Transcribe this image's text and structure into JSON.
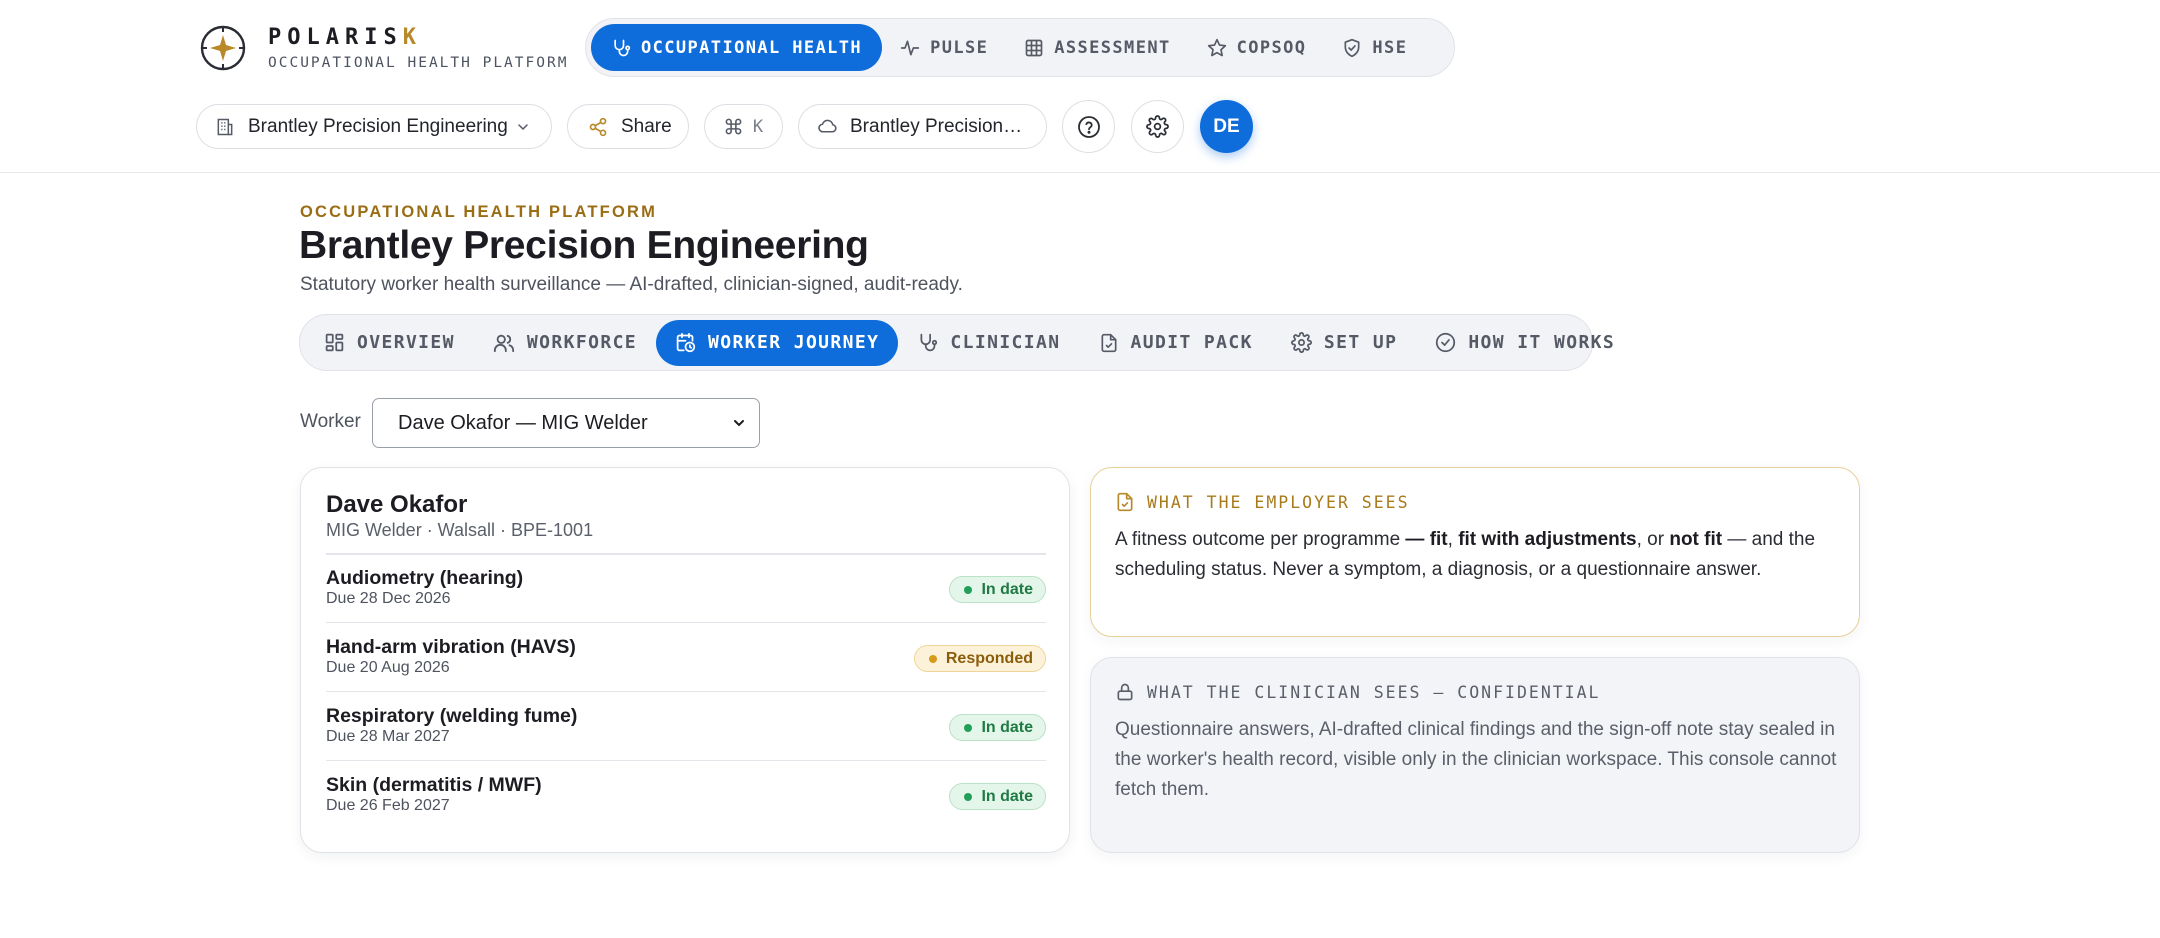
{
  "brand": {
    "name_main": "POLARIS",
    "name_accent": "K",
    "subtitle": "OCCUPATIONAL HEALTH PLATFORM",
    "accent_color": "#b8892a"
  },
  "main_nav": [
    {
      "label": "OCCUPATIONAL HEALTH",
      "icon": "stethoscope-icon",
      "active": true
    },
    {
      "label": "PULSE",
      "icon": "pulse-icon",
      "active": false
    },
    {
      "label": "ASSESSMENT",
      "icon": "grid-icon",
      "active": false
    },
    {
      "label": "COPSOQ",
      "icon": "star-icon",
      "active": false
    },
    {
      "label": "HSE",
      "icon": "shield-check-icon",
      "active": false
    }
  ],
  "toolbar": {
    "org_label": "Brantley Precision Engineering",
    "share_label": "Share",
    "shortcut_key": "K",
    "cloud_label": "Brantley Precision Engineering",
    "avatar_initials": "DE"
  },
  "page": {
    "eyebrow": "OCCUPATIONAL HEALTH PLATFORM",
    "title": "Brantley Precision Engineering",
    "subtitle": "Statutory worker health surveillance — AI-drafted, clinician-signed, audit-ready."
  },
  "sub_nav": [
    {
      "label": "OVERVIEW",
      "icon": "dashboard-icon",
      "active": false
    },
    {
      "label": "WORKFORCE",
      "icon": "users-icon",
      "active": false
    },
    {
      "label": "WORKER JOURNEY",
      "icon": "calendar-clock-icon",
      "active": true
    },
    {
      "label": "CLINICIAN",
      "icon": "stethoscope-icon",
      "active": false
    },
    {
      "label": "AUDIT PACK",
      "icon": "file-check-icon",
      "active": false
    },
    {
      "label": "SET UP",
      "icon": "gear-icon",
      "active": false
    },
    {
      "label": "HOW IT WORKS",
      "icon": "check-circle-icon",
      "active": false
    }
  ],
  "worker_select": {
    "label": "Worker",
    "value": "Dave Okafor — MIG Welder"
  },
  "worker_card": {
    "name": "Dave Okafor",
    "meta": "MIG Welder · Walsall · BPE-1001",
    "programmes": [
      {
        "name": "Audiometry (hearing)",
        "due": "Due 28 Dec 2026",
        "status": "In date",
        "status_type": "ok"
      },
      {
        "name": "Hand-arm vibration (HAVS)",
        "due": "Due 20 Aug 2026",
        "status": "Responded",
        "status_type": "resp"
      },
      {
        "name": "Respiratory (welding fume)",
        "due": "Due 28 Mar 2027",
        "status": "In date",
        "status_type": "ok"
      },
      {
        "name": "Skin (dermatitis / MWF)",
        "due": "Due 26 Feb 2027",
        "status": "In date",
        "status_type": "ok"
      }
    ]
  },
  "employer_panel": {
    "heading": "WHAT THE EMPLOYER SEES",
    "t1": "A fitness outcome per programme ",
    "t2": "— fit",
    "t3": ", ",
    "t4": "fit with adjustments",
    "t5": ", or ",
    "t6": "not fit",
    "t7": " — and the scheduling status. Never a symptom, a diagnosis, or a questionnaire answer."
  },
  "clinician_panel": {
    "heading": "WHAT THE CLINICIAN SEES — CONFIDENTIAL",
    "body": "Questionnaire answers, AI-drafted clinical findings and the sign-off note stay sealed in the worker's health record, visible only in the clinician workspace. This console cannot fetch them."
  },
  "colors": {
    "primary": "#0f6ddb",
    "gold": "#9a6d14",
    "ok": "#1f7a43",
    "responded": "#8a5d0b"
  }
}
